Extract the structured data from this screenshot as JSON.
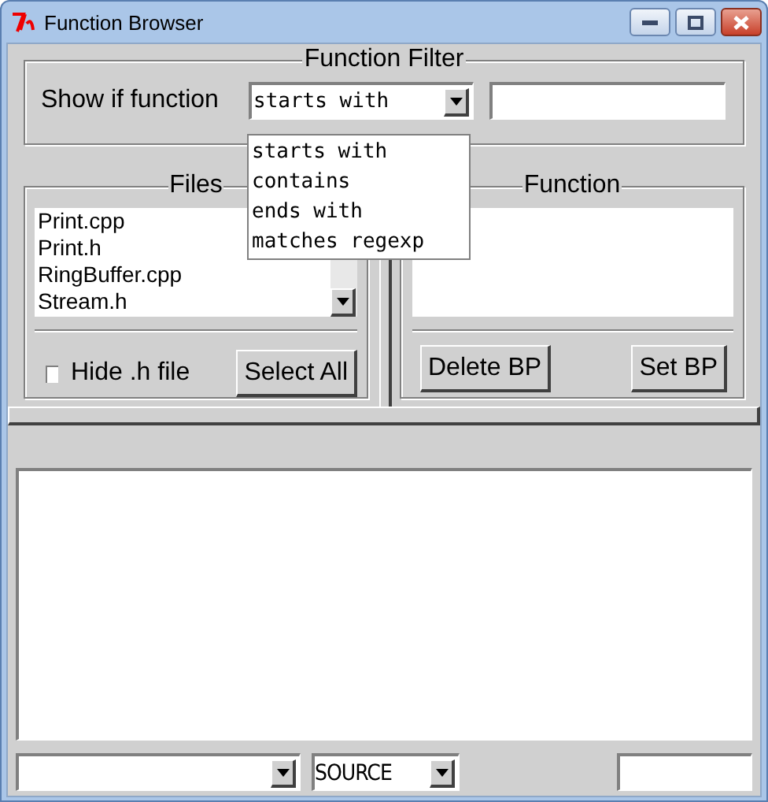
{
  "window": {
    "title": "Function Browser"
  },
  "filter": {
    "title": "Function Filter",
    "label": "Show if function",
    "mode": "starts with",
    "options": [
      {
        "label": "starts with",
        "selected": false
      },
      {
        "label": "contains",
        "selected": false
      },
      {
        "label": "ends with",
        "selected": false
      },
      {
        "label": "matches regexp",
        "selected": false
      }
    ]
  },
  "files": {
    "title": "Files",
    "items": [
      "Print.cpp",
      "Print.h",
      "RingBuffer.cpp",
      "Stream.h"
    ],
    "hide_h": {
      "label": "Hide .h file",
      "checked": false
    },
    "button": "Select All"
  },
  "function": {
    "title": "Function",
    "buttons": [
      "Delete BP",
      "Set BP"
    ]
  },
  "bottom": {
    "mode": "SOURCE"
  }
}
